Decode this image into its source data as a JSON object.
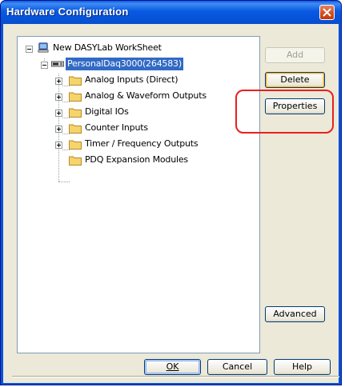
{
  "window": {
    "title": "Hardware Configuration"
  },
  "tree": {
    "root": {
      "label": "New DASYLab WorkSheet",
      "icon": "computer-icon",
      "expanded": true
    },
    "device": {
      "label": "PersonalDaq3000(264583)",
      "icon": "device-icon",
      "expanded": true,
      "selected": true
    },
    "children": [
      {
        "label": "Analog Inputs (Direct)",
        "icon": "folder-icon",
        "expander": "plus"
      },
      {
        "label": "Analog & Waveform Outputs",
        "icon": "folder-icon",
        "expander": "plus"
      },
      {
        "label": "Digital IOs",
        "icon": "folder-icon",
        "expander": "plus"
      },
      {
        "label": "Counter Inputs",
        "icon": "folder-icon",
        "expander": "plus"
      },
      {
        "label": "Timer / Frequency Outputs",
        "icon": "folder-icon",
        "expander": "plus"
      },
      {
        "label": "PDQ Expansion Modules",
        "icon": "folder-icon",
        "expander": "none"
      }
    ]
  },
  "side_buttons": {
    "add": "Add",
    "delete": "Delete",
    "properties": "Properties",
    "advanced": "Advanced"
  },
  "footer_buttons": {
    "ok": "OK",
    "cancel": "Cancel",
    "help": "Help"
  },
  "colors": {
    "title_bar": "#0553d8",
    "selection": "#316ac5",
    "highlight_annotation": "#e8201e",
    "folder": "#f5d46c"
  }
}
